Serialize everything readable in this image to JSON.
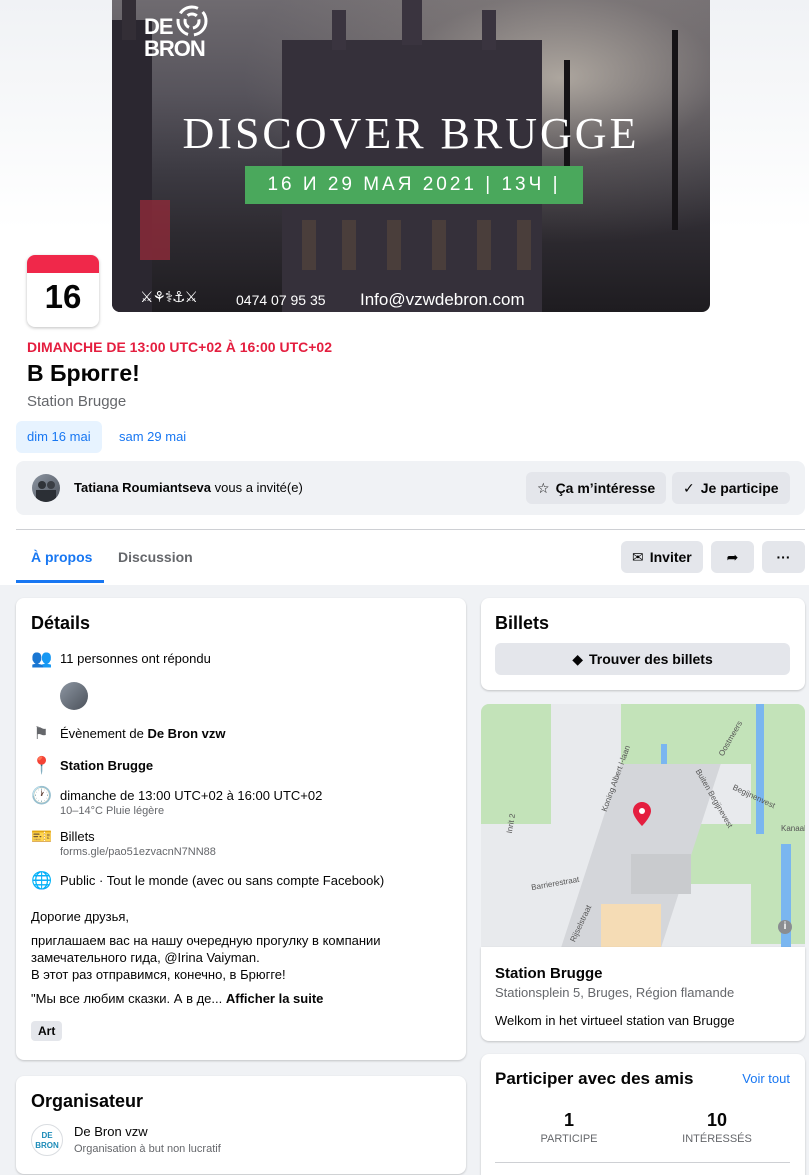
{
  "cover": {
    "logo_line1": "DE",
    "logo_line2": "BRON",
    "title": "DISCOVER BRUGGE",
    "banner": "16 И 29 МАЯ 2021 | 13Ч |",
    "icons": "⚔⚘⚕⚓⚔",
    "phone": "0474 07 95 35",
    "email": "Info@vzwdebron.com"
  },
  "event": {
    "day_number": "16",
    "when": "DIMANCHE DE 13:00 UTC+02 À 16:00 UTC+02",
    "title": "В Брюгге!",
    "location": "Station Brugge",
    "dates": [
      "dim 16 mai",
      "sam 29 mai"
    ]
  },
  "invite": {
    "inviter": "Tatiana Roumiantseva",
    "text": " vous a invité(e)",
    "interested_label": "Ça m’intéresse",
    "going_label": "Je participe"
  },
  "tabs": {
    "about": "À propos",
    "discussion": "Discussion",
    "invite_label": "Inviter",
    "more_label": "···"
  },
  "details": {
    "heading": "Détails",
    "responded": "11 personnes ont répondu",
    "organizer_prefix": "Évènement de ",
    "organizer_name": "De Bron vzw",
    "place": "Station Brugge",
    "time": "dimanche de 13:00 UTC+02 à 16:00 UTC+02",
    "weather": "10–14°C Pluie légère",
    "tickets_label": "Billets",
    "tickets_url": "forms.gle/pao51ezvacnN7NN88",
    "privacy": "Public · Tout le monde (avec ou sans compte Facebook)",
    "desc_line1": "Дорогие друзья,",
    "desc_line2": "приглашаем вас на нашу очередную прогулку в компании",
    "desc_line3": "замечательного гида, @Irina Vaiyman.",
    "desc_line4": "В этот раз отправимся, конечно, в Брюгге!",
    "desc_line5": "\"Мы все любим сказки. А в де...",
    "see_more": "Afficher la suite",
    "tag": "Art"
  },
  "organizer": {
    "heading": "Organisateur",
    "name": "De Bron vzw",
    "type": "Organisation à but non lucratif",
    "logo_text_1": "DE",
    "logo_text_2": "BRON"
  },
  "tickets": {
    "heading": "Billets",
    "button": "Trouver des billets"
  },
  "map": {
    "labels": [
      "Koning Albert I-laan",
      "Buiten Begijnevest",
      "Begijnenvest",
      "Kanaal",
      "Oostmeers",
      "Barrierestraat",
      "Rijselstraat",
      "Inrit 2"
    ],
    "info_icon": "i"
  },
  "station": {
    "name": "Station Brugge",
    "address": "Stationsplein 5, Bruges, Région flamande",
    "description": "Welkom in het virtueel station van Brugge"
  },
  "friends": {
    "heading": "Participer avec des amis",
    "see_all": "Voir tout",
    "going_count": "1",
    "going_label": "PARTICIPE",
    "interested_count": "10",
    "interested_label": "INTÉRESSÉS"
  },
  "colors": {
    "accent": "#1877f2",
    "date_red": "#e41e3f",
    "banner_green": "#4aa85c"
  }
}
